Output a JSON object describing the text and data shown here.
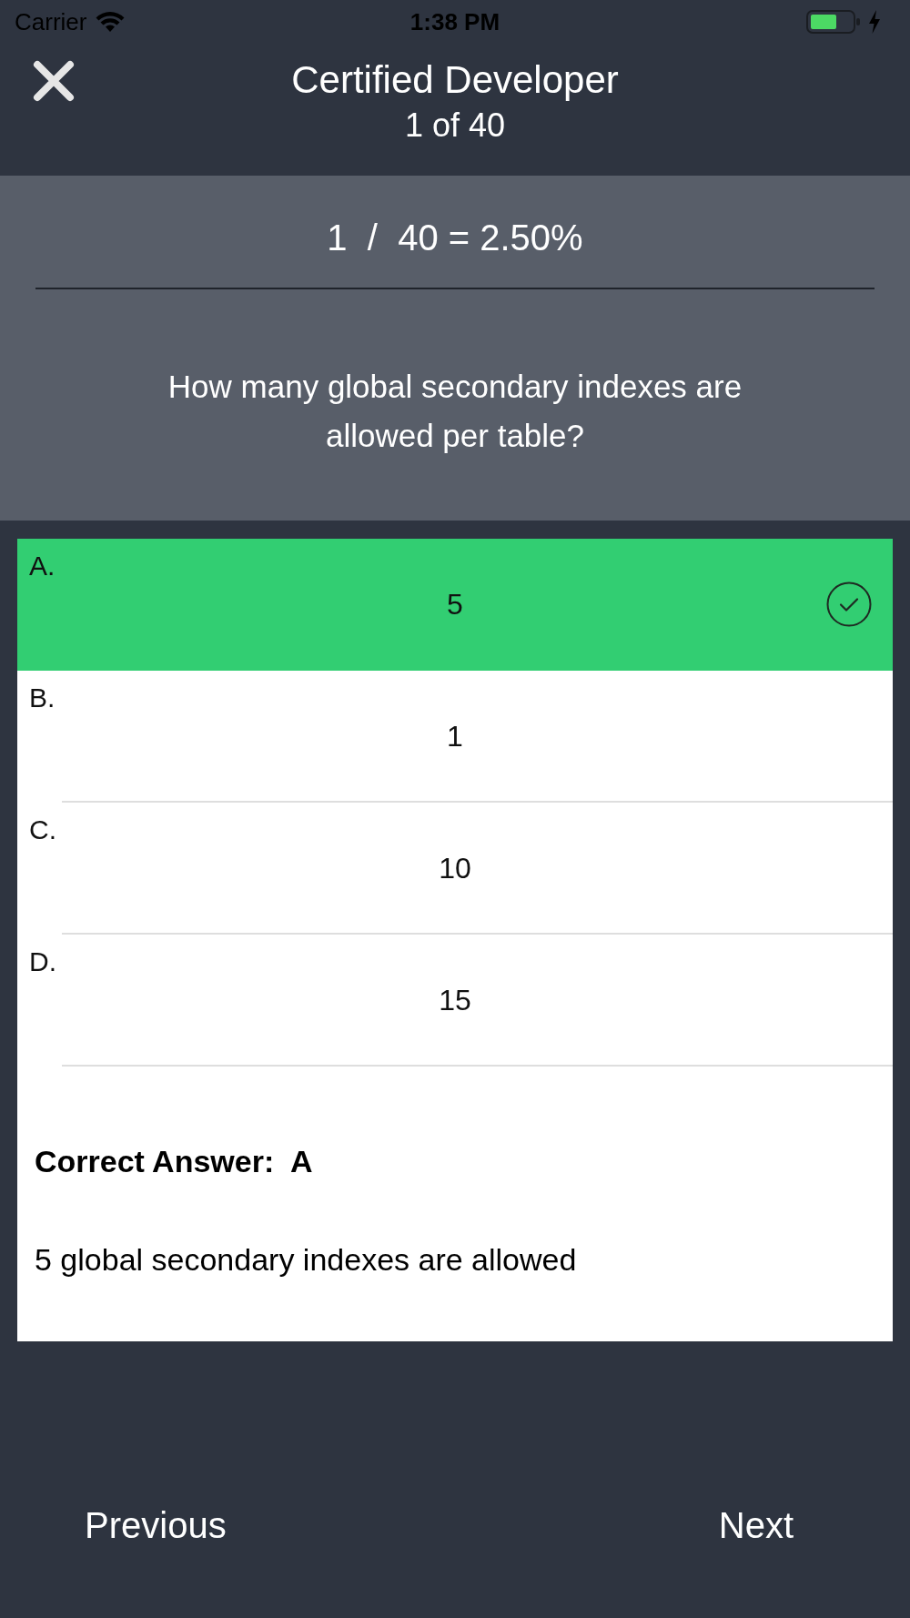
{
  "status_bar": {
    "carrier": "Carrier",
    "time": "1:38 PM"
  },
  "header": {
    "title": "Certified Developer",
    "subtitle": "1 of 40"
  },
  "progress": {
    "text": "1  /  40 = 2.50%"
  },
  "question": "How many global secondary indexes are allowed per table?",
  "answers": [
    {
      "letter": "A.",
      "text": "5",
      "selected": true
    },
    {
      "letter": "B.",
      "text": "1",
      "selected": false
    },
    {
      "letter": "C.",
      "text": "10",
      "selected": false
    },
    {
      "letter": "D.",
      "text": "15",
      "selected": false
    }
  ],
  "correct_answer": "Correct Answer:  A",
  "explanation": "5 global secondary indexes are allowed",
  "nav": {
    "previous": "Previous",
    "next": "Next"
  }
}
